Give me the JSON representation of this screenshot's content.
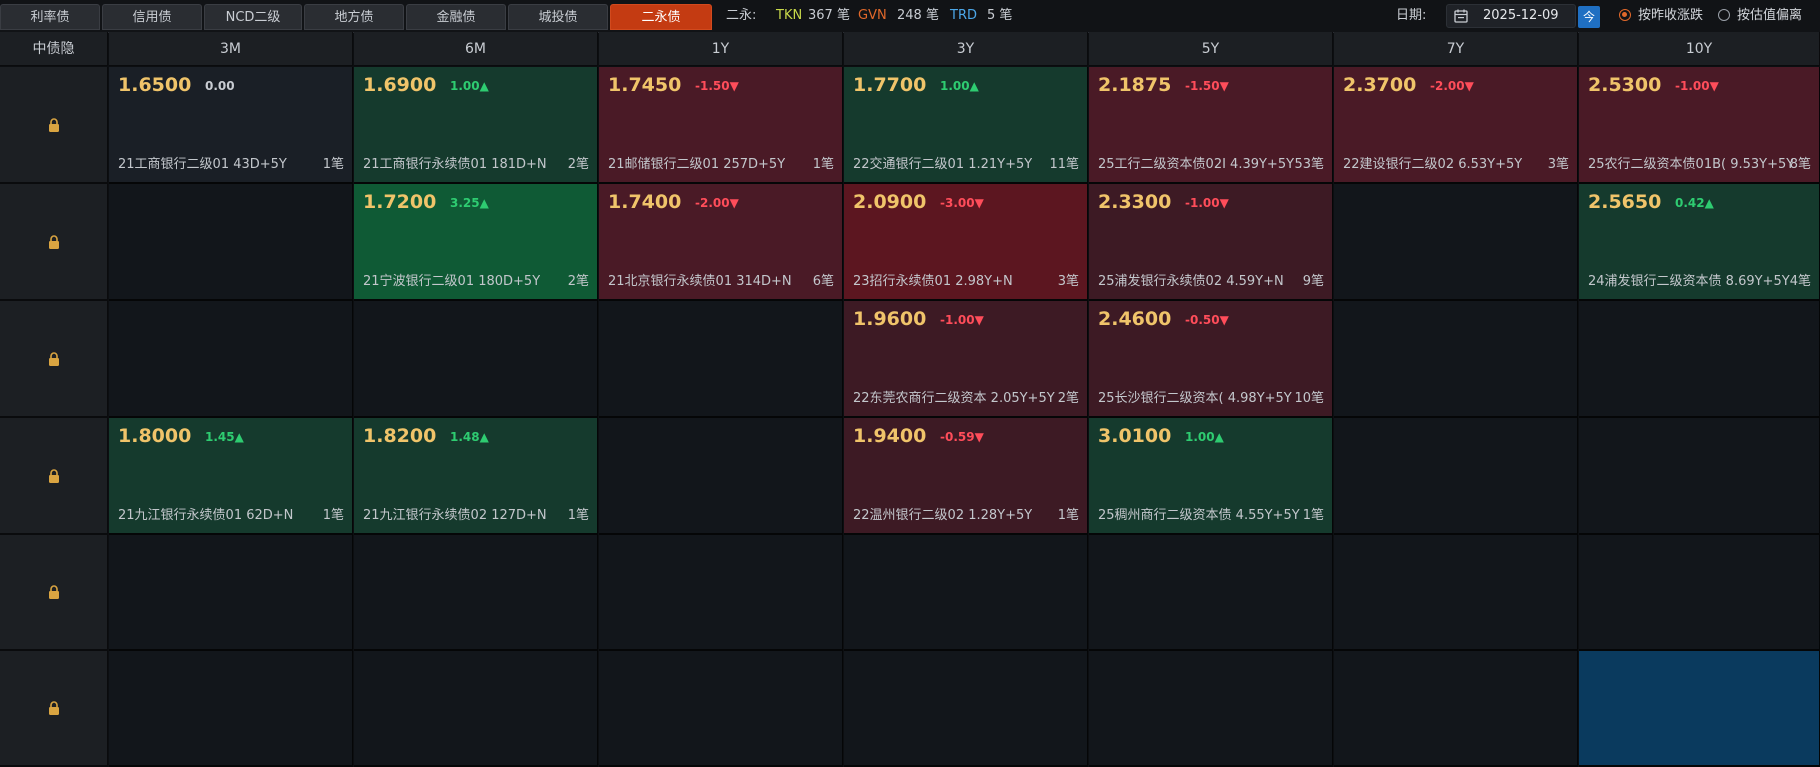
{
  "tabs": [
    {
      "label": "利率债",
      "active": false
    },
    {
      "label": "信用债",
      "active": false
    },
    {
      "label": "NCD二级",
      "active": false
    },
    {
      "label": "地方债",
      "active": false
    },
    {
      "label": "金融债",
      "active": false
    },
    {
      "label": "城投债",
      "active": false
    },
    {
      "label": "二永债",
      "active": true
    }
  ],
  "stats": {
    "prefix": "二永:",
    "tkn_label": "TKN",
    "tkn_count": "367 笔",
    "gvn_label": "GVN",
    "gvn_count": "248 笔",
    "trd_label": "TRD",
    "trd_count": "5 笔"
  },
  "date": {
    "label": "日期:",
    "value": "2025-12-09",
    "today_button": "今"
  },
  "sort_options": [
    {
      "label": "按昨收涨跌",
      "checked": true
    },
    {
      "label": "按估值偏离",
      "checked": false
    }
  ],
  "colors": {
    "tkn": "#c8d94a",
    "gvn": "#e0682a",
    "trd": "#4ca7e8",
    "up": "#2ecc71",
    "down": "#ff4d5a",
    "flat": "#c8ccd2",
    "green_dark": "#153a2d",
    "green_mid": "#11482e",
    "green_bright": "#0f5a35",
    "red_dark": "#3d1a24",
    "red_mid": "#4a1a26",
    "red_bright": "#5c1620",
    "highlight_blue": "#0a3a5e"
  },
  "grid": {
    "corner_label": "中债隐",
    "columns": [
      "3M",
      "6M",
      "1Y",
      "3Y",
      "5Y",
      "7Y",
      "10Y"
    ],
    "rows": [
      [
        {
          "price": "1.6500",
          "change": "0.00",
          "dir": "flat",
          "bond": "21工商银行二级01 43D+5Y",
          "count": "1笔",
          "tone": "neutral"
        },
        {
          "price": "1.6900",
          "change": "1.00▲",
          "dir": "up",
          "bond": "21工商银行永续债01 181D+N",
          "count": "2笔",
          "tone": "green_dark"
        },
        {
          "price": "1.7450",
          "change": "-1.50▼",
          "dir": "down",
          "bond": "21邮储银行二级01 257D+5Y",
          "count": "1笔",
          "tone": "red_mid"
        },
        {
          "price": "1.7700",
          "change": "1.00▲",
          "dir": "up",
          "bond": "22交通银行二级01 1.21Y+5Y",
          "count": "11笔",
          "tone": "green_dark"
        },
        {
          "price": "2.1875",
          "change": "-1.50▼",
          "dir": "down",
          "bond": "25工行二级资本债02I 4.39Y+5Y",
          "count": "53笔",
          "tone": "red_mid"
        },
        {
          "price": "2.3700",
          "change": "-2.00▼",
          "dir": "down",
          "bond": "22建设银行二级02 6.53Y+5Y",
          "count": "3笔",
          "tone": "red_mid"
        },
        {
          "price": "2.5300",
          "change": "-1.00▼",
          "dir": "down",
          "bond": "25农行二级资本债01B( 9.53Y+5Y",
          "count": "8笔",
          "tone": "red_mid"
        }
      ],
      [
        null,
        {
          "price": "1.7200",
          "change": "3.25▲",
          "dir": "up",
          "bond": "21宁波银行二级01 180D+5Y",
          "count": "2笔",
          "tone": "green_bright"
        },
        {
          "price": "1.7400",
          "change": "-2.00▼",
          "dir": "down",
          "bond": "21北京银行永续债01 314D+N",
          "count": "6笔",
          "tone": "red_mid"
        },
        {
          "price": "2.0900",
          "change": "-3.00▼",
          "dir": "down",
          "bond": "23招行永续债01 2.98Y+N",
          "count": "3笔",
          "tone": "red_bright"
        },
        {
          "price": "2.3300",
          "change": "-1.00▼",
          "dir": "down",
          "bond": "25浦发银行永续债02 4.59Y+N",
          "count": "9笔",
          "tone": "red_dark"
        },
        null,
        {
          "price": "2.5650",
          "change": "0.42▲",
          "dir": "up",
          "bond": "24浦发银行二级资本债 8.69Y+5Y",
          "count": "4笔",
          "tone": "green_dark"
        }
      ],
      [
        null,
        null,
        null,
        {
          "price": "1.9600",
          "change": "-1.00▼",
          "dir": "down",
          "bond": "22东莞农商行二级资本 2.05Y+5Y",
          "count": "2笔",
          "tone": "red_dark"
        },
        {
          "price": "2.4600",
          "change": "-0.50▼",
          "dir": "down",
          "bond": "25长沙银行二级资本( 4.98Y+5Y",
          "count": "10笔",
          "tone": "red_dark"
        },
        null,
        null
      ],
      [
        {
          "price": "1.8000",
          "change": "1.45▲",
          "dir": "up",
          "bond": "21九江银行永续债01 62D+N",
          "count": "1笔",
          "tone": "green_dark"
        },
        {
          "price": "1.8200",
          "change": "1.48▲",
          "dir": "up",
          "bond": "21九江银行永续债02 127D+N",
          "count": "1笔",
          "tone": "green_dark"
        },
        null,
        {
          "price": "1.9400",
          "change": "-0.59▼",
          "dir": "down",
          "bond": "22温州银行二级02 1.28Y+5Y",
          "count": "1笔",
          "tone": "red_dark"
        },
        {
          "price": "3.0100",
          "change": "1.00▲",
          "dir": "up",
          "bond": "25稠州商行二级资本债 4.55Y+5Y",
          "count": "1笔",
          "tone": "green_dark"
        },
        null,
        null
      ],
      [
        null,
        null,
        null,
        null,
        null,
        null,
        null
      ],
      [
        null,
        null,
        null,
        null,
        null,
        null,
        {
          "highlight": true
        }
      ]
    ]
  }
}
